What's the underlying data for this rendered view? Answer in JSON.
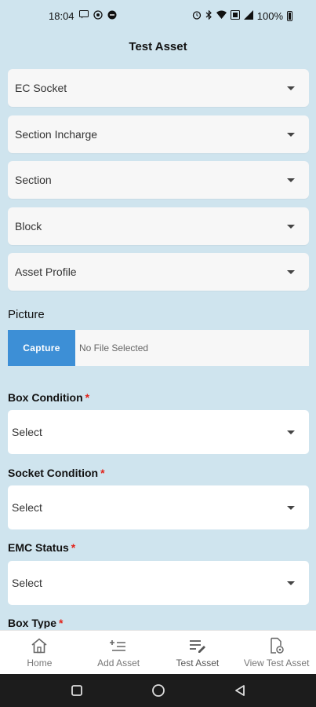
{
  "status_bar": {
    "time": "18:04",
    "battery": "100%",
    "left_icons": [
      "message-icon",
      "whatsapp-icon",
      "notification-icon"
    ],
    "right_icons": [
      "alarm-icon",
      "bluetooth-icon",
      "wifi-icon",
      "nfc-icon",
      "signal-icon",
      "battery-icon"
    ]
  },
  "header": {
    "title": "Test Asset"
  },
  "dropdowns": [
    {
      "label": "EC Socket"
    },
    {
      "label": "Section Incharge"
    },
    {
      "label": "Section"
    },
    {
      "label": "Block"
    },
    {
      "label": "Asset Profile"
    }
  ],
  "picture": {
    "label": "Picture",
    "capture_label": "Capture",
    "file_status": "No File Selected"
  },
  "fields": [
    {
      "label": "Box Condition",
      "required_mark": "*",
      "value": "Select"
    },
    {
      "label": "Socket Condition",
      "required_mark": "*",
      "value": "Select"
    },
    {
      "label": "EMC Status",
      "required_mark": "*",
      "value": "Select"
    },
    {
      "label": "Box Type",
      "required_mark": "*"
    }
  ],
  "bottom_nav": [
    {
      "label": "Home",
      "icon": "home-icon"
    },
    {
      "label": "Add Asset",
      "icon": "add-list-icon"
    },
    {
      "label": "Test Asset",
      "icon": "edit-list-icon",
      "active": true
    },
    {
      "label": "View Test Asset",
      "icon": "view-document-icon"
    }
  ],
  "colors": {
    "background": "#cfe4ee",
    "accent": "#3d8fd6",
    "required": "#e2231a"
  }
}
